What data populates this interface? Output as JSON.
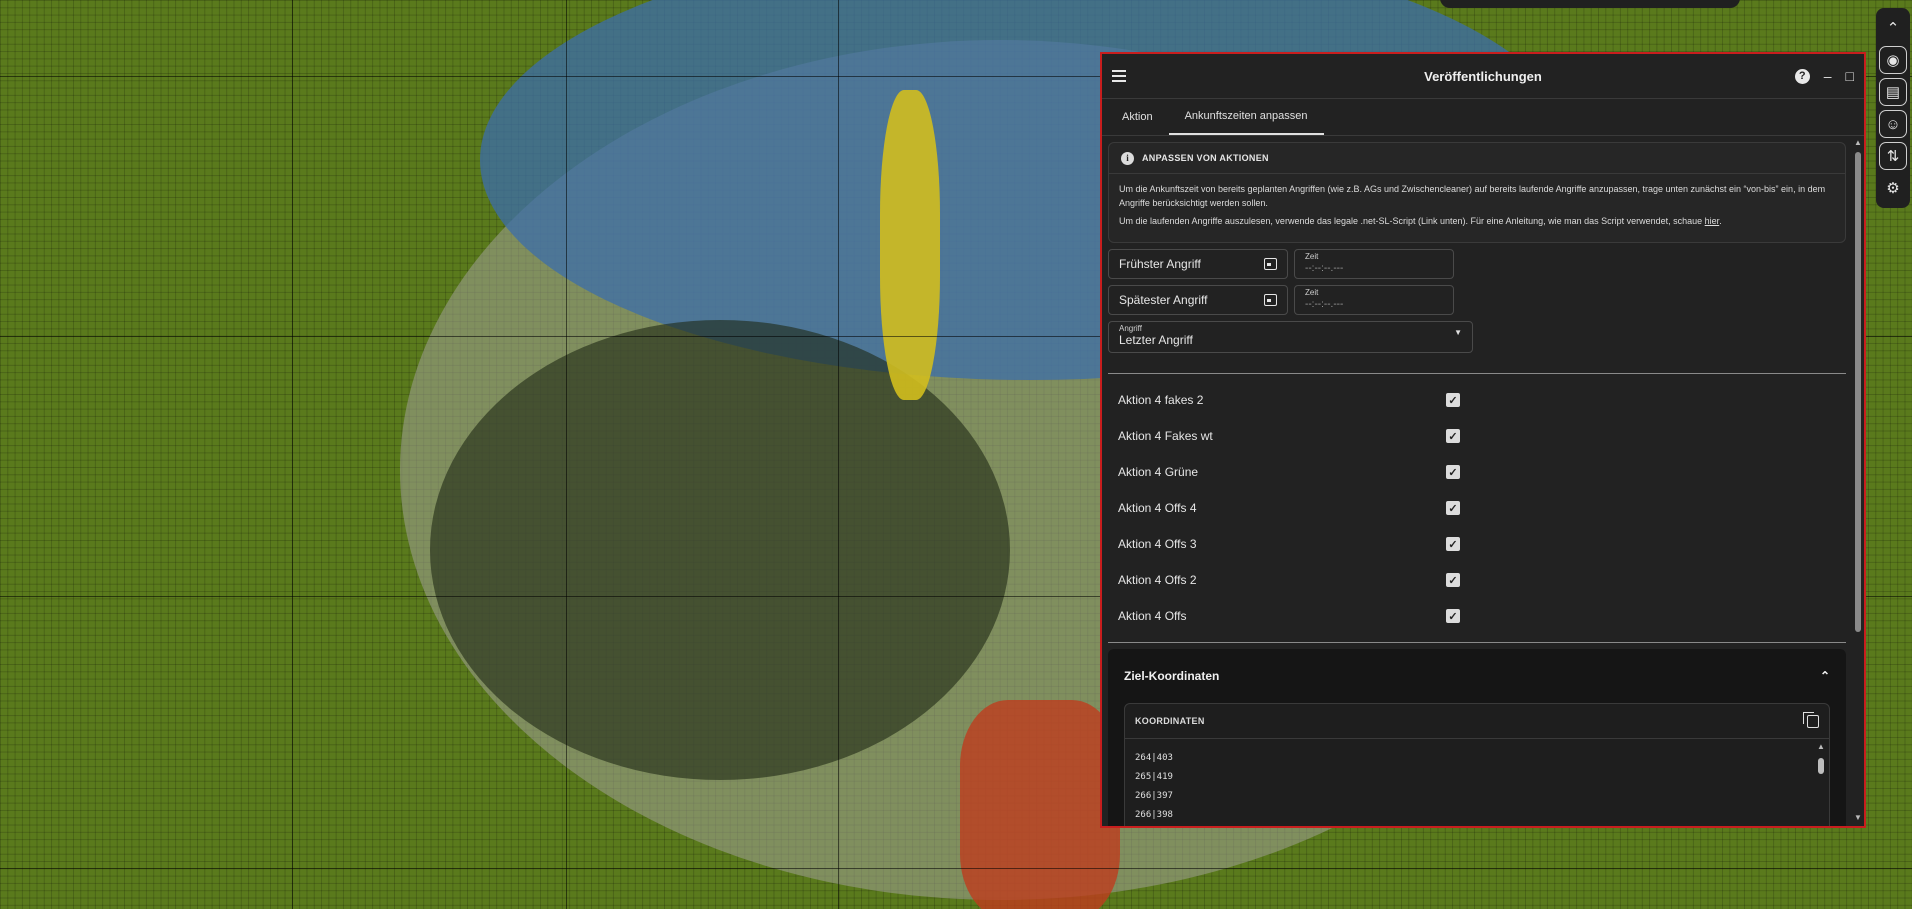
{
  "panel": {
    "title": "Veröffentlichungen",
    "icons": [
      "menu-icon",
      "help-icon",
      "minimize-icon",
      "maximize-icon"
    ]
  },
  "tabs": [
    {
      "label": "Aktion",
      "active": false
    },
    {
      "label": "Ankunftszeiten anpassen",
      "active": true
    }
  ],
  "info": {
    "heading": "ANPASSEN VON AKTIONEN",
    "p1": "Um die Ankunftszeit von bereits geplanten Angriffen (wie z.B. AGs und Zwischencleaner) auf bereits laufende Angriffe anzupassen, trage unten zunächst ein “von-bis” ein, in dem Angriffe berücksichtigt werden sollen.",
    "p2": "Um die laufenden Angriffe auszulesen, verwende das legale .net-SL-Script (Link unten). Für eine Anleitung, wie man das Script verwendet, schaue ",
    "p2_link": "hier",
    "p2_end": "."
  },
  "earliest": {
    "label": "Frühster Angriff",
    "time_label": "Zeit",
    "time_value": "--:--:--.---"
  },
  "latest": {
    "label": "Spätester Angriff",
    "time_label": "Zeit",
    "time_value": "--:--:--.---"
  },
  "attack_select": {
    "label": "Angriff",
    "value": "Letzter Angriff"
  },
  "actions": [
    {
      "label": "Aktion 4 fakes 2",
      "checked": true
    },
    {
      "label": "Aktion 4 Fakes wt",
      "checked": true
    },
    {
      "label": "Aktion 4 Grüne",
      "checked": true
    },
    {
      "label": "Aktion 4 Offs 4",
      "checked": true
    },
    {
      "label": "Aktion 4 Offs 3",
      "checked": true
    },
    {
      "label": "Aktion 4 Offs 2",
      "checked": true
    },
    {
      "label": "Aktion 4 Offs",
      "checked": true
    }
  ],
  "targets": {
    "title": "Ziel-Koordinaten",
    "box_label": "KOORDINATEN",
    "coords": [
      "264|403",
      "265|419",
      "266|397",
      "266|398"
    ]
  },
  "colors": {
    "accent_border": "#c81e1e",
    "panel_bg": "#222222",
    "map_bg": "#5a7a1c"
  }
}
